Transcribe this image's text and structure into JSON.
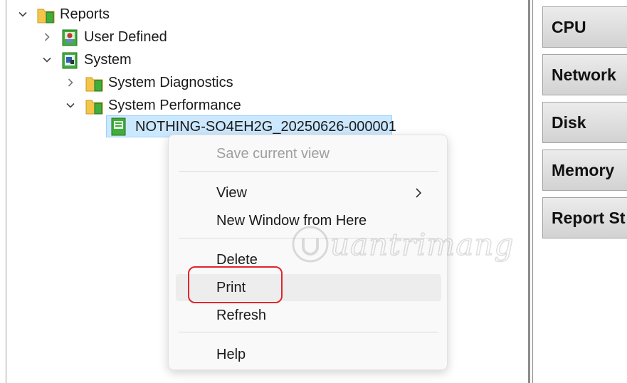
{
  "tree": {
    "nodes": [
      {
        "label": "Reports",
        "expanded": true,
        "icon": "reports-folder-icon"
      },
      {
        "label": "User Defined",
        "expanded": false,
        "icon": "user-defined-icon"
      },
      {
        "label": "System",
        "expanded": true,
        "icon": "system-icon"
      },
      {
        "label": "System Diagnostics",
        "expanded": false,
        "icon": "folder-icon"
      },
      {
        "label": "System Performance",
        "expanded": true,
        "icon": "folder-icon"
      },
      {
        "label": "NOTHING-SO4EH2G_20250626-000001",
        "selected": true,
        "icon": "report-icon"
      }
    ]
  },
  "right_panel": {
    "buttons": [
      "CPU",
      "Network",
      "Disk",
      "Memory",
      "Report St"
    ]
  },
  "context_menu": {
    "items": [
      {
        "label": "Save current view",
        "disabled": true
      },
      {
        "label": "View",
        "has_submenu": true
      },
      {
        "label": "New Window from Here"
      },
      {
        "label": "Delete"
      },
      {
        "label": "Print",
        "highlighted": true
      },
      {
        "label": "Refresh"
      },
      {
        "label": "Help"
      }
    ]
  },
  "watermark": {
    "text": "uantrimang"
  },
  "colors": {
    "selection_bg": "#cce8ff",
    "selection_border": "#99d1ff",
    "highlight_red": "#e0262b",
    "folder_yellow": "#f3c64b",
    "folder_green": "#3fae3a"
  }
}
